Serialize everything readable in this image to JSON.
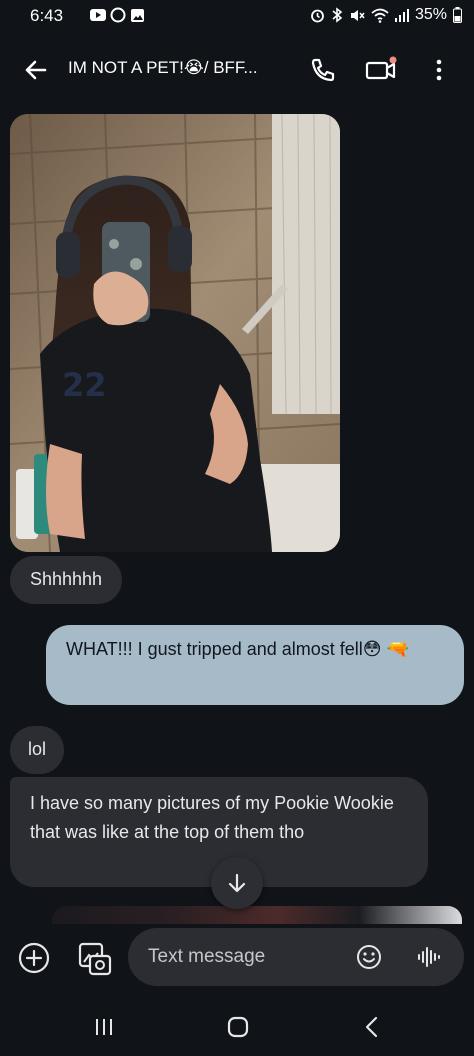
{
  "status_bar": {
    "time": "6:43",
    "battery": "35%"
  },
  "header": {
    "title": "IM NOT A PET!😭/ BFF..."
  },
  "messages": [
    {
      "direction": "in",
      "type": "image"
    },
    {
      "direction": "in",
      "text": "Shhhhhh"
    },
    {
      "direction": "out",
      "text": "WHAT!!! I gust tripped and almost fell😳 🔫"
    },
    {
      "direction": "in",
      "text": "lol"
    },
    {
      "direction": "in",
      "text": "I have so many pictures of my Pookie Wookie that was like at the top of them tho"
    }
  ],
  "composer": {
    "placeholder": "Text message"
  },
  "colors": {
    "background": "#101318",
    "incoming_bubble": "#2b2d33",
    "outgoing_bubble": "#a6bac8",
    "badge": "#f28b82"
  }
}
